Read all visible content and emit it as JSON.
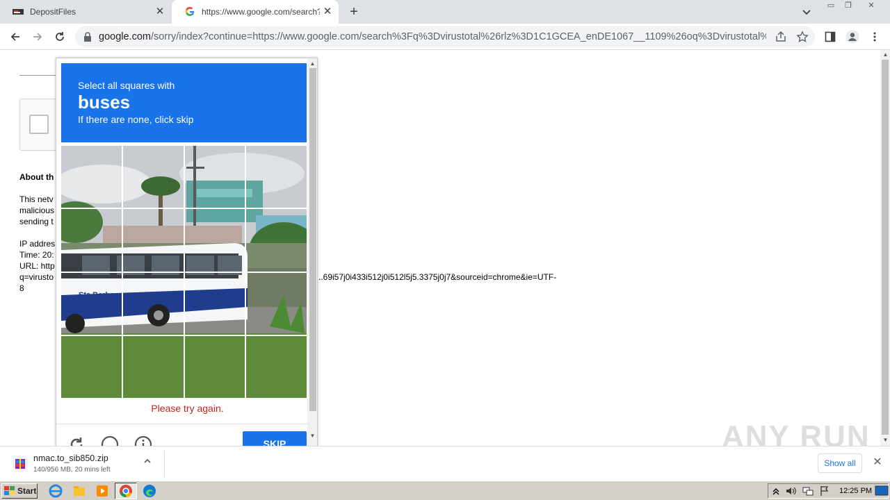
{
  "tabs": [
    {
      "title": "DepositFiles"
    },
    {
      "title": "https://www.google.com/search?q="
    }
  ],
  "window_controls": {
    "minimize": "▭",
    "restore": "❐",
    "close": "✕"
  },
  "address_bar": {
    "host": "google.com",
    "path": "/sorry/index?continue=https://www.google.com/search%3Fq%3Dvirustotal%26rlz%3D1C1GCEA_enDE1067__1109%26oq%3Dvirustotal%..."
  },
  "page": {
    "about_heading": "About th",
    "lines": [
      "This netv",
      "malicious",
      "sending t",
      "IP addres",
      "Time: 20:",
      "URL: http",
      "q=virusto",
      "8"
    ],
    "url_tail": "..69i57j0i433i512j0i512l5j5.3375j0j7&sourceid=chrome&ie=UTF-"
  },
  "challenge": {
    "instruction": "Select all squares with",
    "target": "buses",
    "hint": "If there are none, click skip",
    "error": "Please try again.",
    "skip_label": "SKIP",
    "grid_size": 4
  },
  "download": {
    "filename": "nmac.to_sib850.zip",
    "status": "140/956 MB, 20 mins left",
    "show_all": "Show all"
  },
  "watermark": "ANY RUN",
  "taskbar": {
    "start_label": "Start",
    "clock": "12:25 PM"
  },
  "colors": {
    "challenge_blue": "#1a73e8",
    "error_red": "#c5221f",
    "tab_strip": "#dee1e6",
    "taskbar": "#d4d0c8"
  }
}
